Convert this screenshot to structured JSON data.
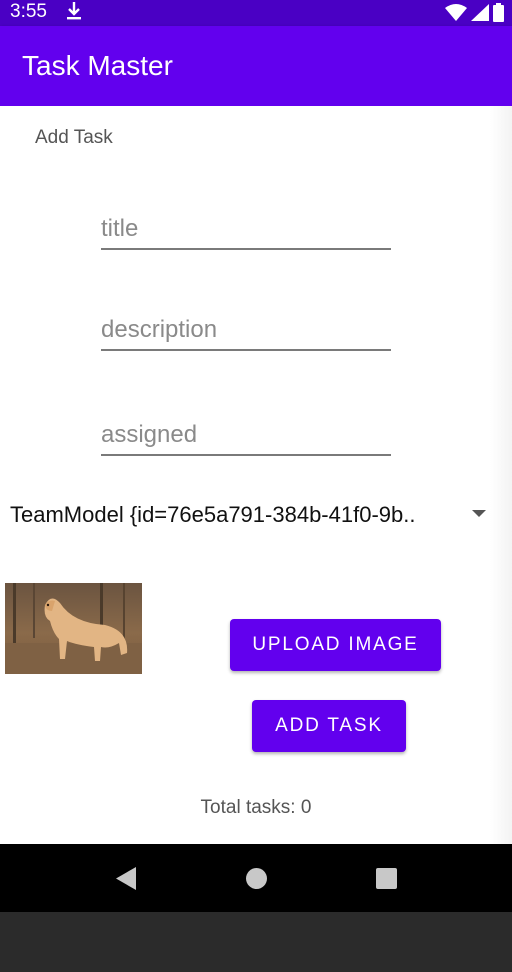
{
  "status_bar": {
    "time": "3:55",
    "icons": [
      "download-icon",
      "wifi-icon",
      "signal-icon",
      "battery-icon"
    ]
  },
  "app_bar": {
    "title": "Task Master"
  },
  "form": {
    "section_title": "Add Task",
    "title_field": {
      "value": "",
      "placeholder": "title"
    },
    "description_field": {
      "value": "",
      "placeholder": "description"
    },
    "assigned_field": {
      "value": "",
      "placeholder": "assigned"
    },
    "team_spinner": {
      "selected": "TeamModel {id=76e5a791-384b-41f0-9b.."
    },
    "upload_image_label": "UPLOAD IMAGE",
    "add_task_label": "ADD TASK",
    "total_tasks": "Total tasks: 0"
  },
  "nav_bar": {
    "icons": [
      "back-icon",
      "home-icon",
      "recents-icon"
    ]
  },
  "colors": {
    "status_bar": "#4a00c4",
    "primary": "#6200ee",
    "button_text": "#ffffff"
  }
}
